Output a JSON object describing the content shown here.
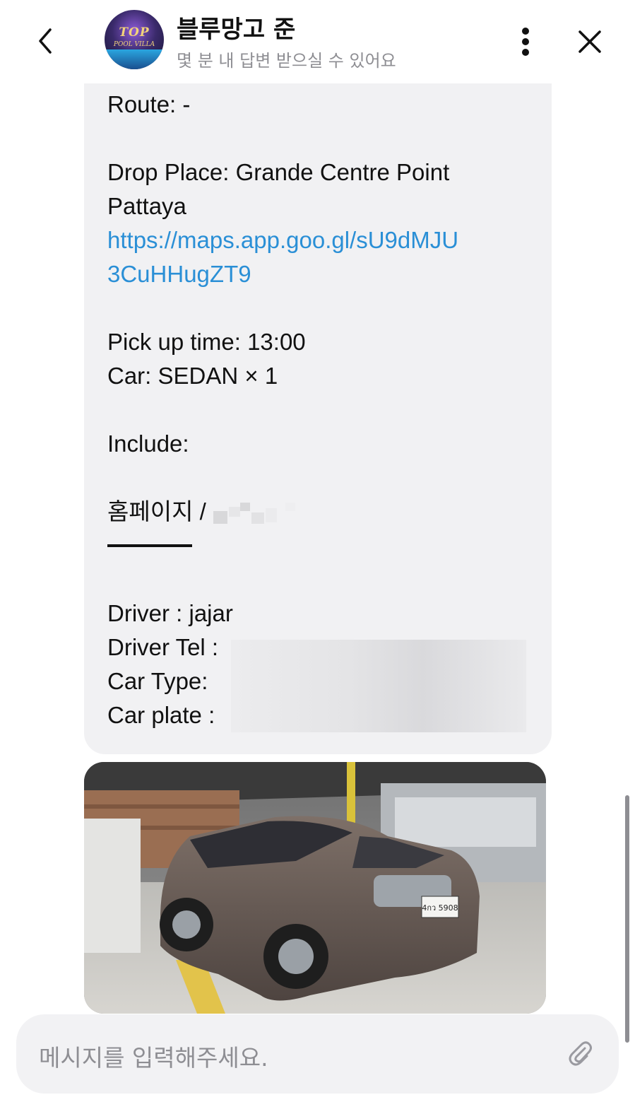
{
  "header": {
    "name": "블루망고 준",
    "status": "몇 분 내 답변 받으실 수 있어요",
    "avatar_logo_line1": "TOP",
    "avatar_logo_line2": "POOL VILLA"
  },
  "message": {
    "route": "Route: -",
    "drop_place_1": "Drop Place: Grande Centre Point",
    "drop_place_2": "Pattaya",
    "link_1": "https://maps.app.goo.gl/sU9dMJU",
    "link_2": "3CuHHugZT9",
    "pickup_time": "Pick up time: 13:00",
    "car": "Car: SEDAN × 1",
    "include": "Include:",
    "homepage": "홈페이지 /",
    "driver": "Driver : jajar",
    "driver_tel": "Driver Tel :",
    "car_type": "Car Type:",
    "car_plate": "Car plate :"
  },
  "photo": {
    "plate_text": "4กว 5908"
  },
  "input": {
    "placeholder": "메시지를 입력해주세요."
  }
}
